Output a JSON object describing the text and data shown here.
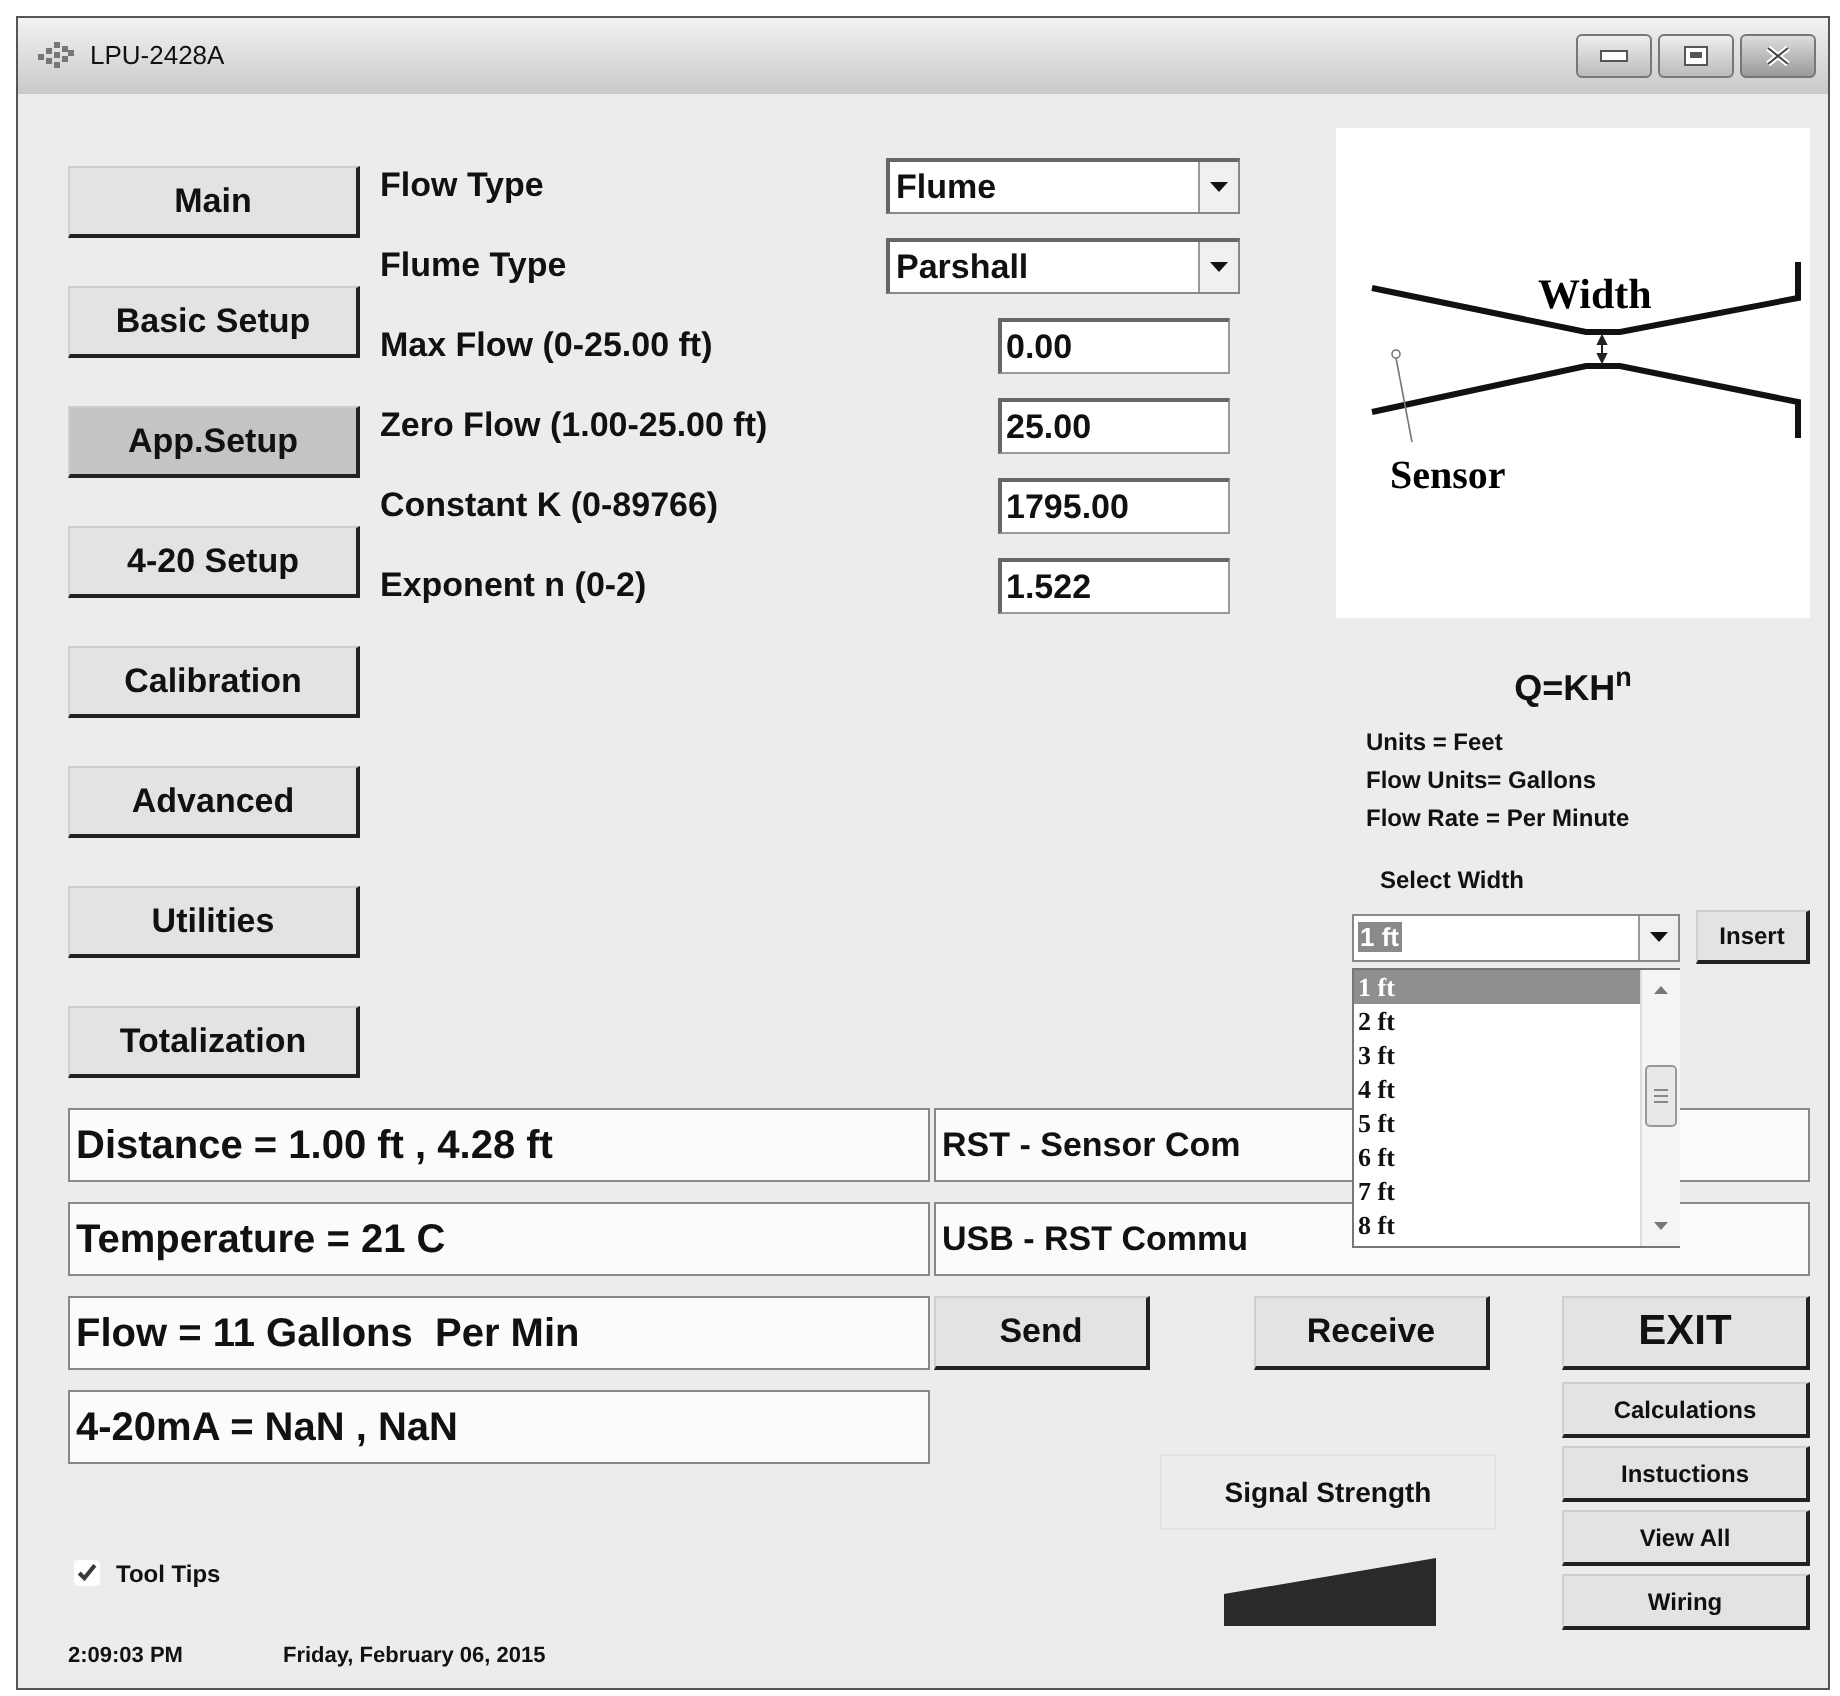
{
  "window": {
    "title": "LPU-2428A"
  },
  "nav": [
    {
      "label": "Main",
      "selected": false
    },
    {
      "label": "Basic Setup",
      "selected": false
    },
    {
      "label": "App.Setup",
      "selected": true
    },
    {
      "label": "4-20 Setup",
      "selected": false
    },
    {
      "label": "Calibration",
      "selected": false
    },
    {
      "label": "Advanced",
      "selected": false
    },
    {
      "label": "Utilities",
      "selected": false
    },
    {
      "label": "Totalization",
      "selected": false
    }
  ],
  "settings": [
    {
      "kind": "select",
      "label": "Flow Type",
      "value": "Flume"
    },
    {
      "kind": "select",
      "label": "Flume Type",
      "value": "Parshall"
    },
    {
      "kind": "input",
      "label": "Max Flow (0-25.00 ft)",
      "value": "0.00"
    },
    {
      "kind": "input",
      "label": "Zero Flow (1.00-25.00 ft)",
      "value": "25.00"
    },
    {
      "kind": "input",
      "label": "Constant K (0-89766)",
      "value": "1795.00"
    },
    {
      "kind": "input",
      "label": "Exponent n (0-2)",
      "value": "1.522"
    }
  ],
  "diagram": {
    "width_label": "Width",
    "sensor_label": "Sensor"
  },
  "formula": "Q=KH$^{n}$",
  "units": [
    "Units = Feet",
    "Flow Units= Gallons",
    "Flow Rate = Per Minute"
  ],
  "width_select": {
    "label": "Select Width",
    "value": "1 ft",
    "expanded": true,
    "button": "Insert",
    "options": [
      {
        "label": "1 ft",
        "selected": true
      },
      {
        "label": "2 ft",
        "selected": false
      },
      {
        "label": "3 ft",
        "selected": false
      },
      {
        "label": "4 ft",
        "selected": false
      },
      {
        "label": "5 ft",
        "selected": false
      },
      {
        "label": "6 ft",
        "selected": false
      },
      {
        "label": "7 ft",
        "selected": false
      },
      {
        "label": "8 ft",
        "selected": false
      }
    ]
  },
  "readouts": [
    "Distance = 1.00 ft , 4.28 ft",
    "Temperature = 21 C",
    "Flow = 11 Gallons  Per Min",
    "4-20mA = NaN , NaN"
  ],
  "comm_status": [
    "RST - Sensor Com",
    "USB - RST Commu"
  ],
  "actions": [
    "Send",
    "Receive"
  ],
  "exit_button": "EXIT",
  "side_buttons": [
    "Calculations",
    "Instuctions",
    "View All",
    "Wiring"
  ],
  "signal": {
    "label": "Signal Strength"
  },
  "tool_tips": {
    "label": "Tool Tips",
    "checked": true
  },
  "status_bar": {
    "time": "2:09:03 PM",
    "date": "Friday, February 06, 2015"
  }
}
